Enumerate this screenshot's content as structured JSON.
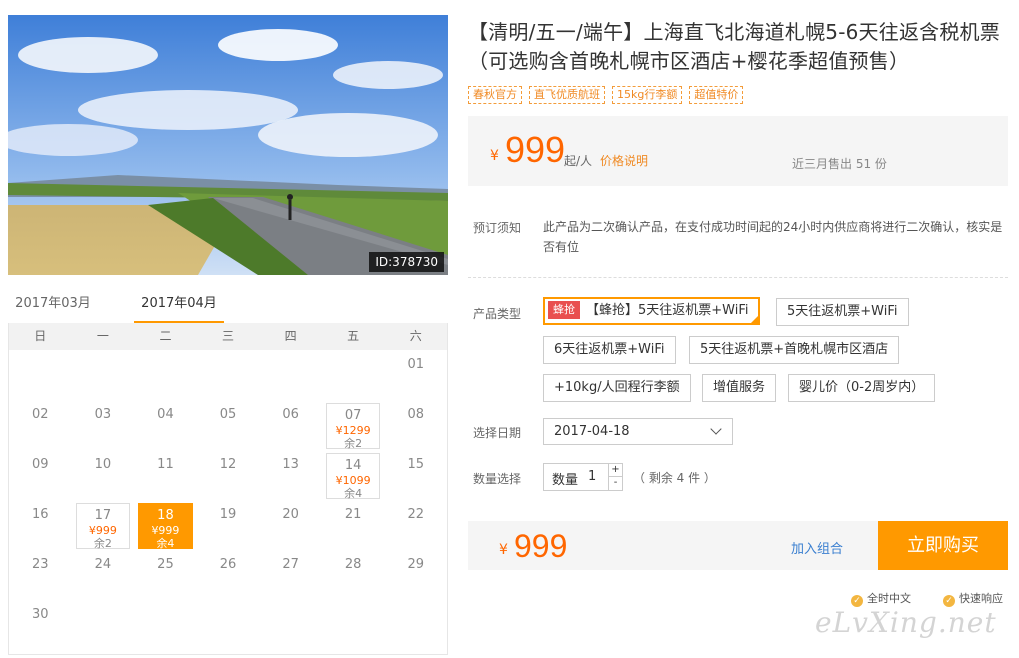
{
  "hero": {
    "id_label": "ID:378730"
  },
  "calendar": {
    "months": [
      "2017年03月",
      "2017年04月"
    ],
    "weekdays": [
      "日",
      "一",
      "二",
      "三",
      "四",
      "五",
      "六"
    ],
    "weeks": [
      [
        null,
        null,
        null,
        null,
        null,
        null,
        {
          "d": "01"
        }
      ],
      [
        {
          "d": "02"
        },
        {
          "d": "03"
        },
        {
          "d": "04"
        },
        {
          "d": "05"
        },
        {
          "d": "06"
        },
        {
          "d": "07",
          "p": "¥1299",
          "r": "余2"
        },
        {
          "d": "08"
        }
      ],
      [
        {
          "d": "09"
        },
        {
          "d": "10"
        },
        {
          "d": "11"
        },
        {
          "d": "12"
        },
        {
          "d": "13"
        },
        {
          "d": "14",
          "p": "¥1099",
          "r": "余4"
        },
        {
          "d": "15"
        }
      ],
      [
        {
          "d": "16"
        },
        {
          "d": "17",
          "p": "¥999",
          "r": "余2"
        },
        {
          "d": "18",
          "p": "¥999",
          "r": "余4",
          "selected": true
        },
        {
          "d": "19"
        },
        {
          "d": "20"
        },
        {
          "d": "21"
        },
        {
          "d": "22"
        }
      ],
      [
        {
          "d": "23"
        },
        {
          "d": "24"
        },
        {
          "d": "25"
        },
        {
          "d": "26"
        },
        {
          "d": "27"
        },
        {
          "d": "28"
        },
        {
          "d": "29"
        }
      ],
      [
        {
          "d": "30"
        },
        null,
        null,
        null,
        null,
        null,
        null
      ]
    ]
  },
  "product": {
    "title": "【清明/五一/端午】上海直飞北海道札幌5-6天往返含税机票（可选购含首晚札幌市区酒店+樱花季超值预售）",
    "tags": [
      "春秋官方",
      "直飞优质航班",
      "15kg行李额",
      "超值特价"
    ]
  },
  "price_box": {
    "currency": "¥",
    "amount": "999",
    "unit": "起/人",
    "explain_link": "价格说明",
    "sold": "近三月售出 51 份"
  },
  "notice": {
    "label": "预订须知",
    "text": "此产品为二次确认产品，在支付成功时间起的24小时内供应商将进行二次确认，核实是否有位"
  },
  "options": {
    "label": "产品类型",
    "badge": "蜂抢",
    "items": [
      "【蜂抢】5天往返机票+WiFi",
      "5天往返机票+WiFi",
      "6天往返机票+WiFi",
      "5天往返机票+首晚札幌市区酒店",
      "+10kg/人回程行李额",
      "增值服务",
      "婴儿价（0-2周岁内）"
    ]
  },
  "date_select": {
    "label": "选择日期",
    "value": "2017-04-18"
  },
  "quantity": {
    "label": "数量选择",
    "field_label": "数量",
    "value": "1",
    "plus": "+",
    "minus": "-",
    "remain": "（ 剩余 4 件 ）"
  },
  "buy_bar": {
    "currency": "¥",
    "amount": "999",
    "add_combo": "加入组合",
    "buy_now": "立即购买"
  },
  "assurances": [
    "全时中文",
    "快速响应"
  ],
  "watermark": "eLvXing.net",
  "colors": {
    "accent": "#ff9900",
    "price": "#ff6600",
    "badge": "#e94f4f",
    "link": "#3a7fd0"
  }
}
